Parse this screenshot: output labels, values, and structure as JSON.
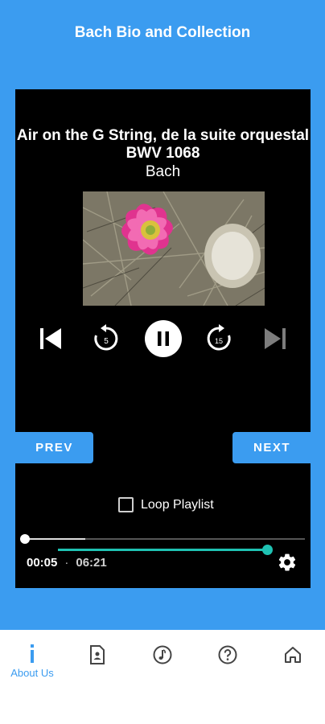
{
  "app": {
    "title": "Bach Bio and Collection"
  },
  "track": {
    "title_line1": "Air on the G String, de la suite orquestal",
    "title_line2": "BWV 1068",
    "artist": "Bach"
  },
  "controls": {
    "skip_previous": "skip-previous-icon",
    "replay": "replay-5-icon",
    "replay_label": "5",
    "pause": "pause-icon",
    "forward": "forward-15-icon",
    "forward_label": "15",
    "skip_next": "skip-next-icon"
  },
  "buttons": {
    "prev_label": "PREV",
    "next_label": "NEXT"
  },
  "loop": {
    "label": "Loop Playlist",
    "checked": false
  },
  "playback": {
    "current_time": "00:05",
    "separator": "·",
    "duration": "06:21",
    "seek_progress_fraction": 0.22,
    "volume_fraction": 1.0
  },
  "colors": {
    "accent": "#3b9cf0",
    "volume": "#1fc2b3",
    "player_bg": "#000000"
  },
  "bottom_nav": {
    "items": [
      {
        "label": "About Us",
        "icon": "info-icon",
        "active": true
      },
      {
        "label": "",
        "icon": "bio-document-icon",
        "active": false
      },
      {
        "label": "",
        "icon": "music-note-icon",
        "active": false
      },
      {
        "label": "",
        "icon": "help-icon",
        "active": false
      },
      {
        "label": "",
        "icon": "home-icon",
        "active": false
      }
    ]
  }
}
